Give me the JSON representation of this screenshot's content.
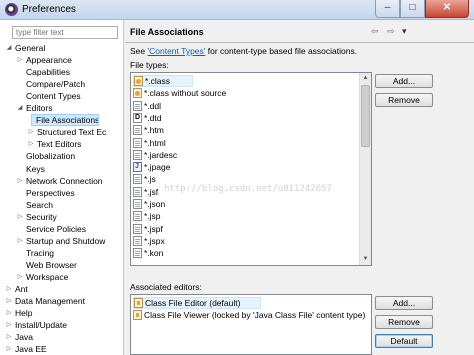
{
  "window": {
    "title": "Preferences",
    "controls": {
      "minimize": "–",
      "maximize": "□",
      "close": "✕"
    }
  },
  "sidebar": {
    "filter_placeholder": "type filter text",
    "tree": [
      {
        "label": "General",
        "twisty": "◢",
        "indent": 0
      },
      {
        "label": "Appearance",
        "twisty": "▷",
        "indent": 1
      },
      {
        "label": "Capabilities",
        "twisty": "",
        "indent": 1
      },
      {
        "label": "Compare/Patch",
        "twisty": "",
        "indent": 1
      },
      {
        "label": "Content Types",
        "twisty": "",
        "indent": 1
      },
      {
        "label": "Editors",
        "twisty": "◢",
        "indent": 1
      },
      {
        "label": "File Associations",
        "twisty": "",
        "indent": 2,
        "selected": true
      },
      {
        "label": "Structured Text Ec",
        "twisty": "▷",
        "indent": 2
      },
      {
        "label": "Text Editors",
        "twisty": "▷",
        "indent": 2
      },
      {
        "label": "Globalization",
        "twisty": "",
        "indent": 1
      },
      {
        "label": "Keys",
        "twisty": "",
        "indent": 1
      },
      {
        "label": "Network Connection",
        "twisty": "▷",
        "indent": 1
      },
      {
        "label": "Perspectives",
        "twisty": "",
        "indent": 1
      },
      {
        "label": "Search",
        "twisty": "",
        "indent": 1
      },
      {
        "label": "Security",
        "twisty": "▷",
        "indent": 1
      },
      {
        "label": "Service Policies",
        "twisty": "",
        "indent": 1
      },
      {
        "label": "Startup and Shutdow",
        "twisty": "▷",
        "indent": 1
      },
      {
        "label": "Tracing",
        "twisty": "",
        "indent": 1
      },
      {
        "label": "Web Browser",
        "twisty": "",
        "indent": 1
      },
      {
        "label": "Workspace",
        "twisty": "▷",
        "indent": 1
      },
      {
        "label": "Ant",
        "twisty": "▷",
        "indent": 0
      },
      {
        "label": "Data Management",
        "twisty": "▷",
        "indent": 0
      },
      {
        "label": "Help",
        "twisty": "▷",
        "indent": 0
      },
      {
        "label": "Install/Update",
        "twisty": "▷",
        "indent": 0
      },
      {
        "label": "Java",
        "twisty": "▷",
        "indent": 0
      },
      {
        "label": "Java EE",
        "twisty": "▷",
        "indent": 0
      }
    ]
  },
  "page": {
    "title": "File Associations",
    "nav": {
      "back": "⇦",
      "forward": "⇨",
      "menu": "▾"
    },
    "description_prefix": "See ",
    "description_link": "'Content Types'",
    "description_suffix": " for content-type based file associations.",
    "file_types_label": "File types:",
    "file_types": [
      {
        "label": "*.class",
        "icon": "class-file-icon",
        "selected": true
      },
      {
        "label": "*.class without source",
        "icon": "class-file-icon"
      },
      {
        "label": "*.ddl",
        "icon": "text-file-icon"
      },
      {
        "label": "*.dtd",
        "icon": "dtd-file-icon"
      },
      {
        "label": "*.htm",
        "icon": "text-file-icon"
      },
      {
        "label": "*.html",
        "icon": "text-file-icon"
      },
      {
        "label": "*.jardesc",
        "icon": "text-file-icon"
      },
      {
        "label": "*.jpage",
        "icon": "java-file-icon"
      },
      {
        "label": "*.js",
        "icon": "text-file-icon"
      },
      {
        "label": "*.jsf",
        "icon": "text-file-icon"
      },
      {
        "label": "*.json",
        "icon": "text-file-icon"
      },
      {
        "label": "*.jsp",
        "icon": "text-file-icon"
      },
      {
        "label": "*.jspf",
        "icon": "text-file-icon"
      },
      {
        "label": "*.jspx",
        "icon": "text-file-icon"
      },
      {
        "label": "*.kon",
        "icon": "text-file-icon"
      }
    ],
    "add_label": "Add...",
    "remove_label": "Remove",
    "associated_label": "Associated editors:",
    "editors": [
      {
        "label": "Class File Editor (default)",
        "icon": "editor-icon",
        "selected": true
      },
      {
        "label": "Class File Viewer (locked by 'Java Class File' content type)",
        "icon": "editor-icon"
      }
    ],
    "editor_add_label": "Add...",
    "editor_remove_label": "Remove",
    "default_label": "Default"
  },
  "watermark": "http://blog.csdn.net/u011242657"
}
